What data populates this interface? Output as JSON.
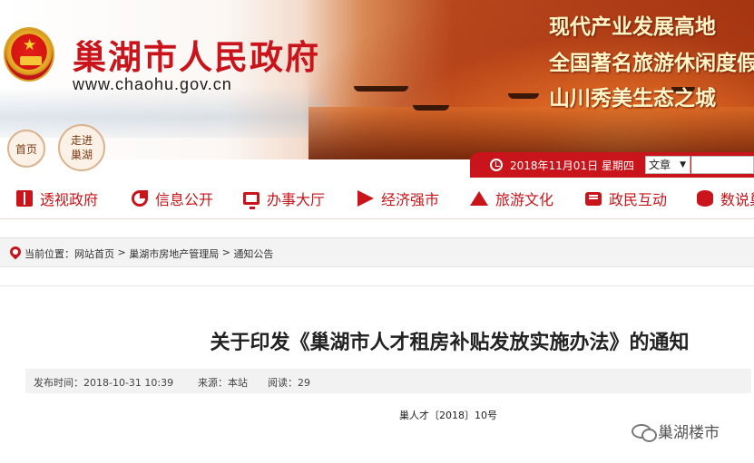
{
  "header": {
    "site_title": "巢湖市人民政府",
    "site_url": "www.chaohu.gov.cn",
    "slogans": [
      "现代产业发展高地",
      "全国著名旅游休闲度假",
      "山川秀美生态之城"
    ],
    "home_label": "首页",
    "walk_label_line1": "走进",
    "walk_label_line2": "巢湖",
    "date_text": "2018年11月01日 星期四",
    "search_scope": "文章",
    "search_value": ""
  },
  "nav": {
    "items": [
      {
        "label": "透视政府",
        "icon": "book-icon"
      },
      {
        "label": "信息公开",
        "icon": "pie-chart-icon"
      },
      {
        "label": "办事大厅",
        "icon": "monitor-icon"
      },
      {
        "label": "经济强市",
        "icon": "paper-plane-icon"
      },
      {
        "label": "旅游文化",
        "icon": "mountain-icon"
      },
      {
        "label": "政民互动",
        "icon": "message-icon"
      },
      {
        "label": "数说巢",
        "icon": "database-icon"
      }
    ]
  },
  "breadcrumb": {
    "prefix": "当前位置：",
    "items": [
      "网站首页",
      "巢湖市房地产管理局",
      "通知公告"
    ],
    "separator": " > "
  },
  "article": {
    "title": "关于印发《巢湖市人才租房补贴发放实施办法》的通知",
    "publish_time": "发布时间：2018-10-31 10:39",
    "source": "来源：本站",
    "views": "阅读：29",
    "doc_number": "巢人才〔2018〕10号"
  },
  "watermark": {
    "text": "巢湖楼市"
  },
  "colors": {
    "brand_red": "#c8141a",
    "meta_bg": "#f2f2f2"
  }
}
